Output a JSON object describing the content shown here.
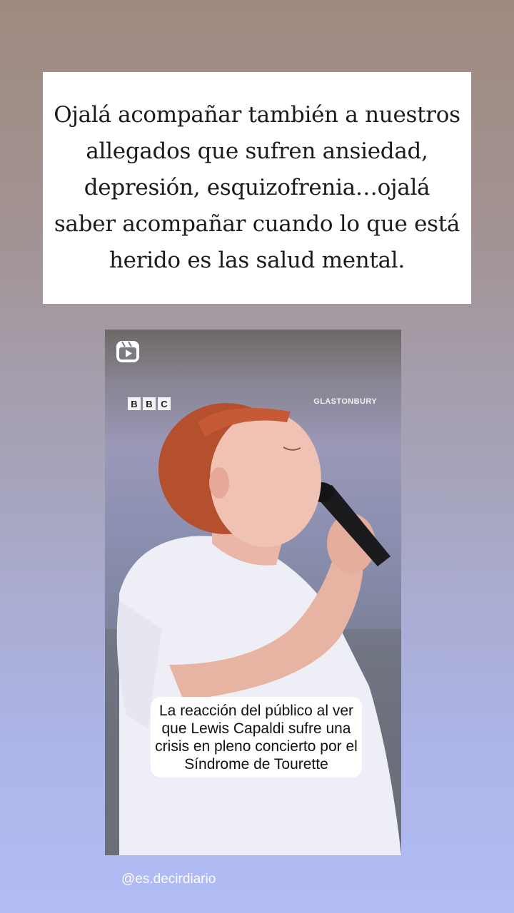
{
  "quote": {
    "text": "Ojalá acompañar también a nuestros allegados que sufren ansiedad, depresión, esquizofrenia…ojalá saber acompañar cuando lo que está herido es las salud mental."
  },
  "video": {
    "brand_letters": [
      "B",
      "B",
      "C"
    ],
    "venue": "GLASTONBURY",
    "caption": "La reacción del público al ver que Lewis Capaldi sufre una crisis en pleno concierto por el Síndrome de Tourette",
    "icon": "reels-icon"
  },
  "footer": {
    "username": "@es.decirdiario"
  },
  "colors": {
    "background_top": "#a08a80",
    "background_bottom": "#b2bcf5",
    "caption_bg": "#ffffff"
  }
}
